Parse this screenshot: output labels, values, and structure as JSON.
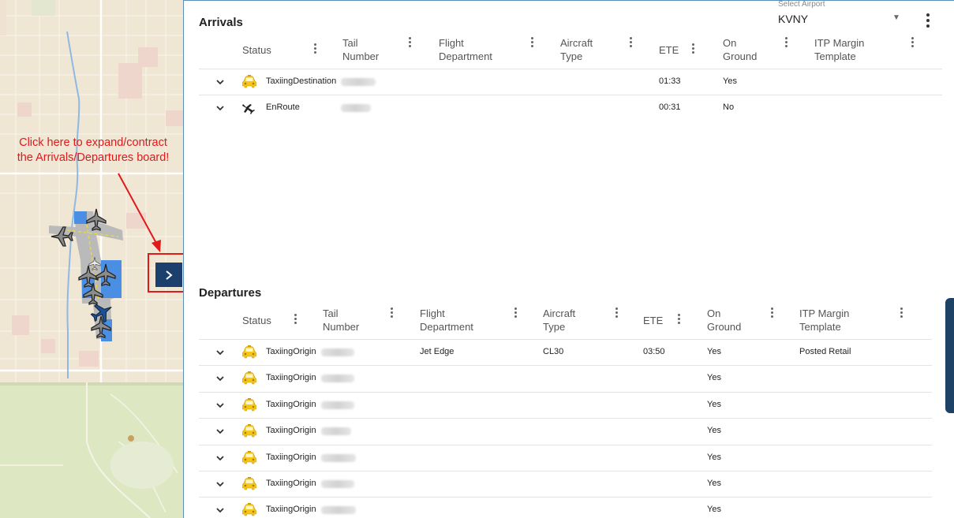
{
  "annotation": {
    "line1": "Click here to expand/contract",
    "line2": "the Arrivals/Departures board!"
  },
  "airport_select": {
    "label": "Select Airport",
    "value": "KVNY"
  },
  "arrivals": {
    "title": "Arrivals",
    "columns": [
      "Status",
      "Tail Number",
      "Flight Department",
      "Aircraft Type",
      "ETE",
      "On Ground",
      "ITP Margin Template"
    ],
    "rows": [
      {
        "status": "TaxiingDestination",
        "status_icon": "taxi-icon",
        "flight_department": "",
        "aircraft_type": "",
        "ete": "01:33",
        "on_ground": "Yes",
        "itp": ""
      },
      {
        "status": "EnRoute",
        "status_icon": "plane-enroute-icon",
        "flight_department": "",
        "aircraft_type": "",
        "ete": "00:31",
        "on_ground": "No",
        "itp": ""
      }
    ]
  },
  "departures": {
    "title": "Departures",
    "columns": [
      "Status",
      "Tail Number",
      "Flight Department",
      "Aircraft Type",
      "ETE",
      "On Ground",
      "ITP Margin Template"
    ],
    "rows": [
      {
        "status": "TaxiingOrigin",
        "status_icon": "taxi-icon",
        "flight_department": "Jet Edge",
        "aircraft_type": "CL30",
        "ete": "03:50",
        "on_ground": "Yes",
        "itp": "Posted Retail"
      },
      {
        "status": "TaxiingOrigin",
        "status_icon": "taxi-icon",
        "flight_department": "",
        "aircraft_type": "",
        "ete": "",
        "on_ground": "Yes",
        "itp": ""
      },
      {
        "status": "TaxiingOrigin",
        "status_icon": "taxi-icon",
        "flight_department": "",
        "aircraft_type": "",
        "ete": "",
        "on_ground": "Yes",
        "itp": ""
      },
      {
        "status": "TaxiingOrigin",
        "status_icon": "taxi-icon",
        "flight_department": "",
        "aircraft_type": "",
        "ete": "",
        "on_ground": "Yes",
        "itp": ""
      },
      {
        "status": "TaxiingOrigin",
        "status_icon": "taxi-icon",
        "flight_department": "",
        "aircraft_type": "",
        "ete": "",
        "on_ground": "Yes",
        "itp": ""
      },
      {
        "status": "TaxiingOrigin",
        "status_icon": "taxi-icon",
        "flight_department": "",
        "aircraft_type": "",
        "ete": "",
        "on_ground": "Yes",
        "itp": ""
      },
      {
        "status": "TaxiingOrigin",
        "status_icon": "taxi-icon",
        "flight_department": "",
        "aircraft_type": "",
        "ete": "",
        "on_ground": "Yes",
        "itp": ""
      }
    ]
  },
  "icons": {
    "expand_button": "chevron-right-icon",
    "row_toggle": "chevron-down-icon",
    "menu": "kebab-menu-icon",
    "dropdown": "caret-down-icon"
  },
  "colors": {
    "taxi": "#f5c518",
    "expand_button": "#1d3f6e",
    "annotation": "#e0191b",
    "enroute_aircraft": "#1d4f9c"
  }
}
